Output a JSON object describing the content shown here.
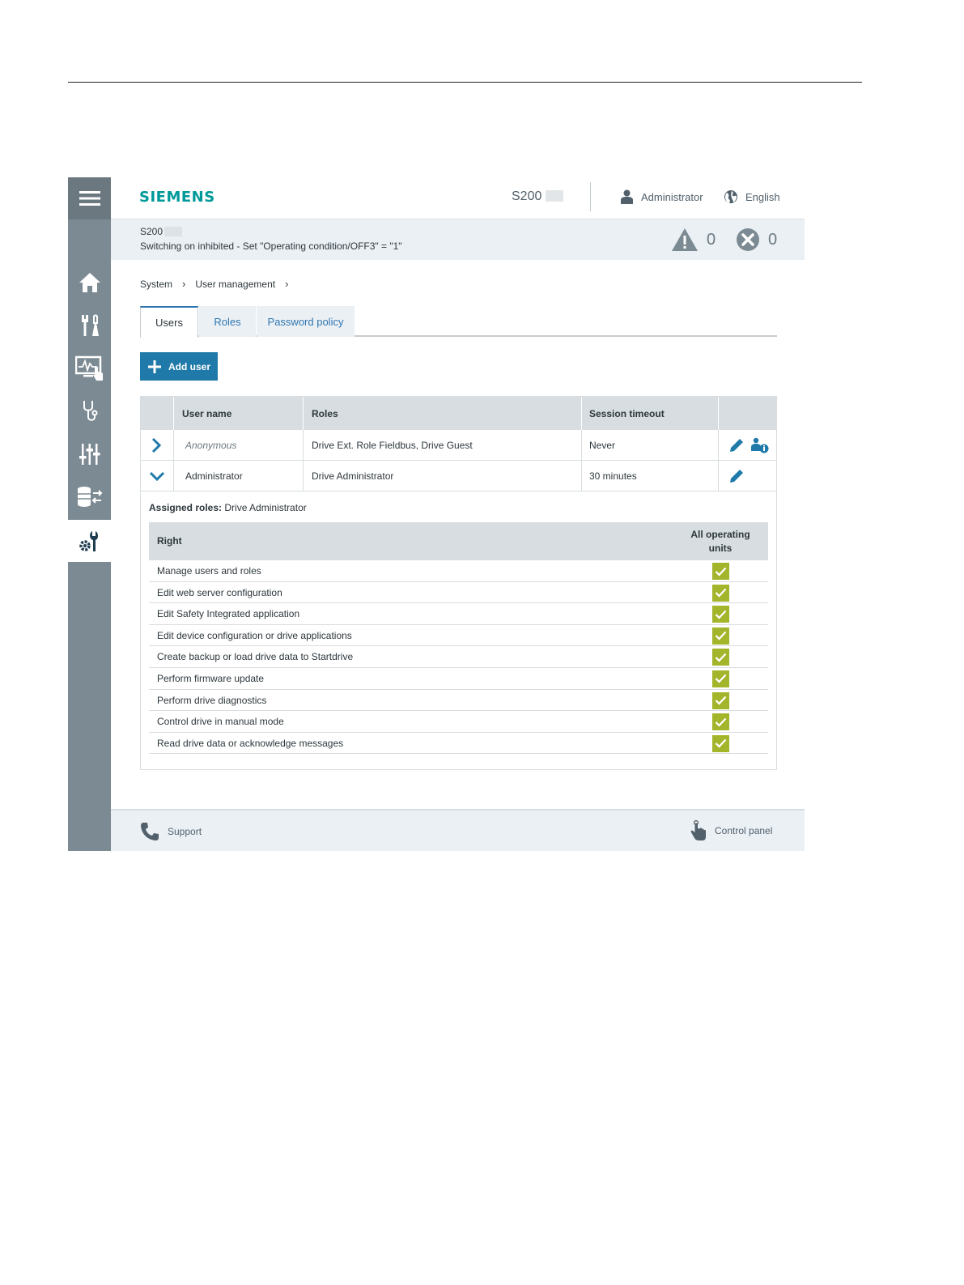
{
  "header": {
    "logo": "SIEMENS",
    "device": "S200",
    "user": "Administrator",
    "language": "English"
  },
  "status": {
    "device": "S200",
    "message": "Switching on inhibited - Set \"Operating condition/OFF3\" = \"1\"",
    "warnings": "0",
    "errors": "0"
  },
  "sidebar": {
    "items": [
      {
        "icon": "home-icon"
      },
      {
        "icon": "commissioning-icon"
      },
      {
        "icon": "monitor-icon"
      },
      {
        "icon": "diagnostics-icon"
      },
      {
        "icon": "parameters-icon"
      },
      {
        "icon": "backup-icon"
      },
      {
        "icon": "system-icon",
        "active": true
      }
    ]
  },
  "breadcrumb": [
    "System",
    "User management"
  ],
  "tabs": [
    "Users",
    "Roles",
    "Password policy"
  ],
  "add_user_label": "Add user",
  "users_table": {
    "columns": [
      "User name",
      "Roles",
      "Session timeout"
    ],
    "rows": [
      {
        "user": "Anonymous",
        "roles": "Drive Ext. Role Fieldbus, Drive Guest",
        "timeout": "Never"
      },
      {
        "user": "Administrator",
        "roles": "Drive Administrator",
        "timeout": "30 minutes"
      }
    ]
  },
  "assigned": {
    "label": "Assigned roles:",
    "value": "Drive Administrator"
  },
  "rights_table": {
    "col_right": "Right",
    "col_all_1": "All operating",
    "col_all_2": "units",
    "colors": {
      "check": "#a3b52b"
    },
    "rows": [
      "Manage users and roles",
      "Edit web server configuration",
      "Edit Safety Integrated application",
      "Edit device configuration or drive applications",
      "Create backup or load drive data to Startdrive",
      "Perform firmware update",
      "Perform drive diagnostics",
      "Control drive in manual mode",
      "Read drive data or acknowledge messages"
    ]
  },
  "footer": {
    "support": "Support",
    "control_panel": "Control panel"
  }
}
